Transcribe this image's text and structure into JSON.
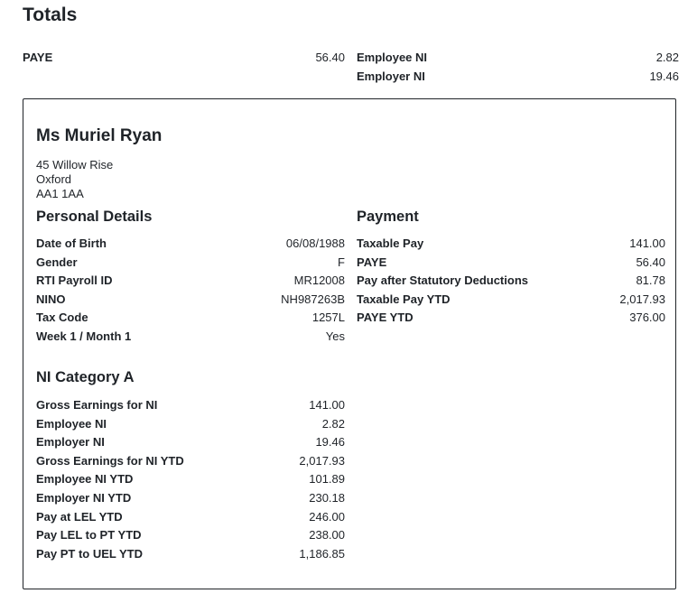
{
  "totals": {
    "title": "Totals",
    "left": [
      {
        "label": "PAYE",
        "value": "56.40"
      }
    ],
    "right": [
      {
        "label": "Employee NI",
        "value": "2.82"
      },
      {
        "label": "Employer NI",
        "value": "19.46"
      }
    ]
  },
  "employee": {
    "name": "Ms Muriel Ryan",
    "address": [
      "45 Willow Rise",
      "Oxford",
      "AA1 1AA"
    ]
  },
  "personal": {
    "title": "Personal Details",
    "rows": [
      {
        "label": "Date of Birth",
        "value": "06/08/1988"
      },
      {
        "label": "Gender",
        "value": "F"
      },
      {
        "label": "RTI Payroll ID",
        "value": "MR12008"
      },
      {
        "label": "NINO",
        "value": "NH987263B"
      },
      {
        "label": "Tax Code",
        "value": "1257L"
      },
      {
        "label": "Week 1 / Month 1",
        "value": "Yes"
      }
    ]
  },
  "payment": {
    "title": "Payment",
    "rows": [
      {
        "label": "Taxable Pay",
        "value": "141.00"
      },
      {
        "label": "PAYE",
        "value": "56.40"
      },
      {
        "label": "Pay after Statutory Deductions",
        "value": "81.78"
      },
      {
        "label": "Taxable Pay YTD",
        "value": "2,017.93"
      },
      {
        "label": "PAYE YTD",
        "value": "376.00"
      }
    ]
  },
  "ni": {
    "title": "NI Category A",
    "rows": [
      {
        "label": "Gross Earnings for NI",
        "value": "141.00"
      },
      {
        "label": "Employee NI",
        "value": "2.82"
      },
      {
        "label": "Employer NI",
        "value": "19.46"
      },
      {
        "label": "Gross Earnings for NI YTD",
        "value": "2,017.93"
      },
      {
        "label": "Employee NI YTD",
        "value": "101.89"
      },
      {
        "label": "Employer NI YTD",
        "value": "230.18"
      },
      {
        "label": "Pay at LEL YTD",
        "value": "246.00"
      },
      {
        "label": "Pay LEL to PT YTD",
        "value": "238.00"
      },
      {
        "label": "Pay PT to UEL YTD",
        "value": "1,186.85"
      }
    ]
  }
}
